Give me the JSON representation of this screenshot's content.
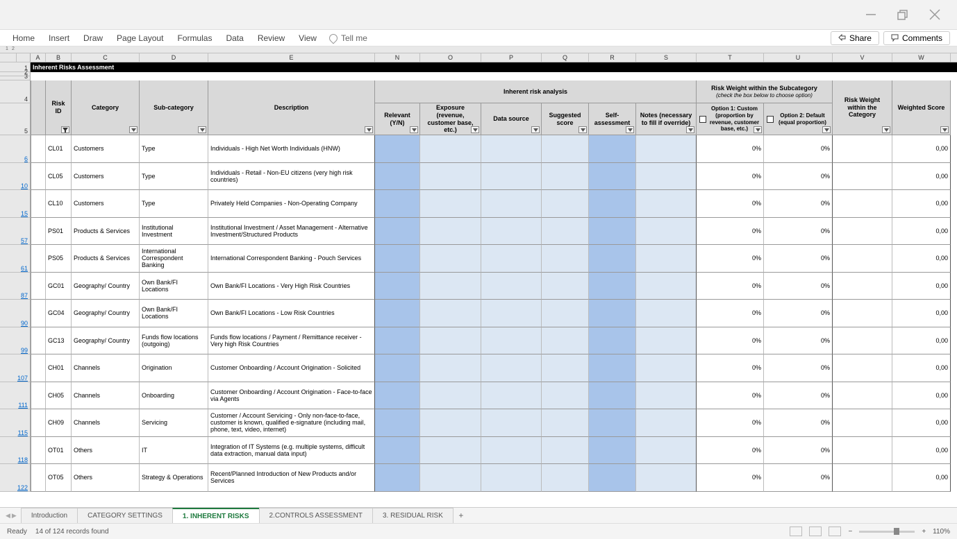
{
  "ribbon": {
    "tabs": [
      "Home",
      "Insert",
      "Draw",
      "Page Layout",
      "Formulas",
      "Data",
      "Review",
      "View"
    ],
    "tellme": "Tell me",
    "share": "Share",
    "comments": "Comments"
  },
  "columns": [
    "A",
    "B",
    "C",
    "D",
    "E",
    "N",
    "O",
    "P",
    "Q",
    "R",
    "S",
    "T",
    "U",
    "V",
    "W"
  ],
  "outline_levels": [
    "1",
    "2"
  ],
  "title_band": "Inherent Risks Assessment",
  "headers": {
    "risk_id": "Risk ID",
    "category": "Category",
    "sub_category": "Sub-category",
    "description": "Description",
    "inherent_analysis": "Inherent risk analysis",
    "risk_weight_subcat": "Risk Weight within the Subcategory",
    "risk_weight_subcat_hint": "(check the box below to choose option)",
    "relevant": "Relevant (Y/N)",
    "exposure": "Exposure (revenue, customer base, etc.)",
    "data_source": "Data source",
    "suggested_score": "Suggested score",
    "self_assessment": "Self-assessment",
    "notes": "Notes (necessary to fill if override)",
    "option1": "Option 1: Custom (proportion by revenue, customer base, etc.)",
    "option2": "Option 2: Default (equal proportion)",
    "risk_weight_cat": "Risk Weight within the Category",
    "weighted_score": "Weighted Score"
  },
  "body_row_numbers": [
    "1",
    "2",
    "3",
    "4",
    "5"
  ],
  "rows": [
    {
      "n": "6",
      "id": "CL01",
      "cat": "Customers",
      "sub": "Type",
      "desc": "Individuals - High Net Worth Individuals (HNW)",
      "t": "0%",
      "u": "0%",
      "w": "0,00"
    },
    {
      "n": "10",
      "id": "CL05",
      "cat": "Customers",
      "sub": "Type",
      "desc": "Individuals - Retail - Non-EU citizens (very high risk countries)",
      "t": "0%",
      "u": "0%",
      "w": "0,00"
    },
    {
      "n": "15",
      "id": "CL10",
      "cat": "Customers",
      "sub": "Type",
      "desc": "Privately Held Companies - Non-Operating Company",
      "t": "0%",
      "u": "0%",
      "w": "0,00"
    },
    {
      "n": "57",
      "id": "PS01",
      "cat": "Products & Services",
      "sub": "Institutional Investment",
      "desc": "Institutional Investment / Asset Management - Alternative Investment/Structured Products",
      "t": "0%",
      "u": "0%",
      "w": "0,00"
    },
    {
      "n": "61",
      "id": "PS05",
      "cat": "Products & Services",
      "sub": "International Correspondent Banking",
      "desc": "International Correspondent Banking - Pouch Services",
      "t": "0%",
      "u": "0%",
      "w": "0,00"
    },
    {
      "n": "87",
      "id": "GC01",
      "cat": "Geography/ Country",
      "sub": "Own Bank/FI Locations",
      "desc": "Own Bank/FI Locations - Very High Risk Countries",
      "t": "0%",
      "u": "0%",
      "w": "0,00"
    },
    {
      "n": "90",
      "id": "GC04",
      "cat": "Geography/ Country",
      "sub": "Own Bank/FI Locations",
      "desc": "Own Bank/FI Locations - Low Risk Countries",
      "t": "0%",
      "u": "0%",
      "w": "0,00"
    },
    {
      "n": "99",
      "id": "GC13",
      "cat": "Geography/ Country",
      "sub": "Funds flow locations (outgoing)",
      "desc": "Funds flow locations / Payment / Remittance receiver - Very high Risk Countries",
      "t": "0%",
      "u": "0%",
      "w": "0,00"
    },
    {
      "n": "107",
      "id": "CH01",
      "cat": "Channels",
      "sub": "Origination",
      "desc": "Customer Onboarding / Account Origination - Solicited",
      "t": "0%",
      "u": "0%",
      "w": "0,00"
    },
    {
      "n": "111",
      "id": "CH05",
      "cat": "Channels",
      "sub": "Onboarding",
      "desc": "Customer Onboarding / Account Origination - Face-to-face via Agents",
      "t": "0%",
      "u": "0%",
      "w": "0,00"
    },
    {
      "n": "115",
      "id": "CH09",
      "cat": "Channels",
      "sub": "Servicing",
      "desc": "Customer / Account Servicing - Only non-face-to-face, customer is known, qualified e-signature (including mail, phone, text, video, internet)",
      "t": "0%",
      "u": "0%",
      "w": "0,00"
    },
    {
      "n": "118",
      "id": "OT01",
      "cat": "Others",
      "sub": "IT",
      "desc": "Integration of IT Systems (e.g. multiple systems, difficult data extraction, manual data input)",
      "t": "0%",
      "u": "0%",
      "w": "0,00"
    },
    {
      "n": "122",
      "id": "OT05",
      "cat": "Others",
      "sub": "Strategy & Operations",
      "desc": "Recent/Planned Introduction of New Products and/or Services",
      "t": "0%",
      "u": "0%",
      "w": "0,00"
    }
  ],
  "sheet_tabs": {
    "items": [
      "Introduction",
      "CATEGORY SETTINGS",
      "1. INHERENT RISKS",
      "2.CONTROLS ASSESSMENT",
      "3. RESIDUAL RISK"
    ],
    "active_index": 2
  },
  "status": {
    "ready": "Ready",
    "records": "14 of 124 records found",
    "zoom": "110%"
  },
  "col_widths": {
    "A": 22,
    "B": 37,
    "C": 98,
    "D": 99,
    "E": 240,
    "N": 65,
    "O": 88,
    "P": 87,
    "Q": 68,
    "R": 68,
    "S": 87,
    "T": 97,
    "U": 99,
    "V": 86,
    "W": 84
  }
}
